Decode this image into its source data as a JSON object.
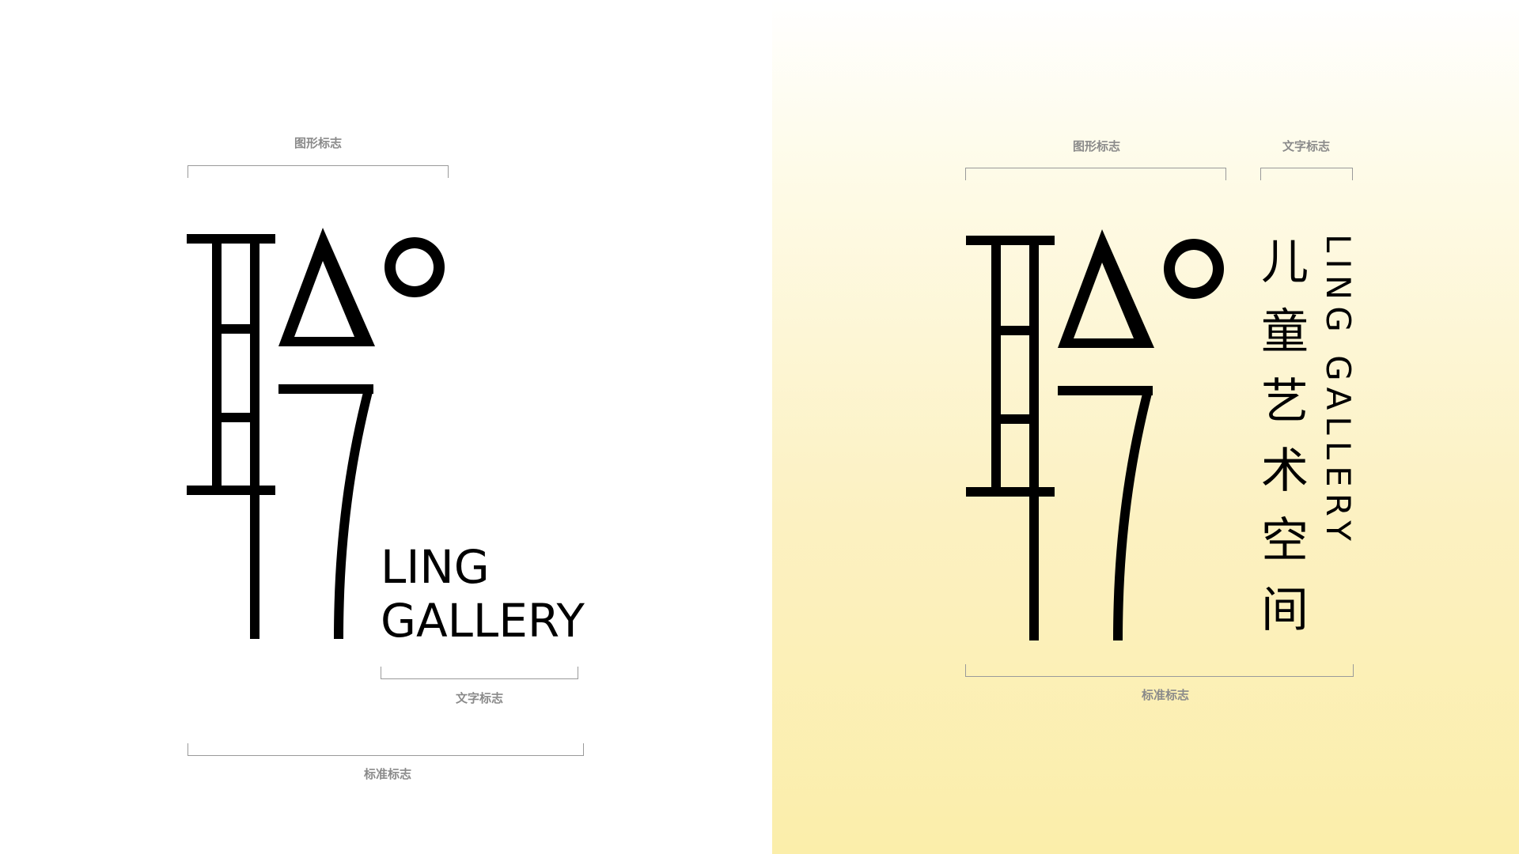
{
  "left_panel": {
    "caption_graphic": "图形标志",
    "caption_text": "文字标志",
    "caption_standard": "标准标志",
    "wordmark_line1": "LING",
    "wordmark_line2": "GALLERY"
  },
  "right_panel": {
    "caption_graphic": "图形标志",
    "caption_text": "文字标志",
    "caption_standard": "标准标志",
    "vertical_cn": [
      "儿",
      "童",
      "艺",
      "术",
      "空",
      "间"
    ],
    "vertical_en": "LING GALLERY"
  },
  "colors": {
    "ink": "#000000",
    "caption": "#8a8a8a",
    "bracket": "#9a9a9a",
    "gradient_bottom": "#fbeeaa"
  },
  "icons": [
    "ling-character-logo"
  ]
}
